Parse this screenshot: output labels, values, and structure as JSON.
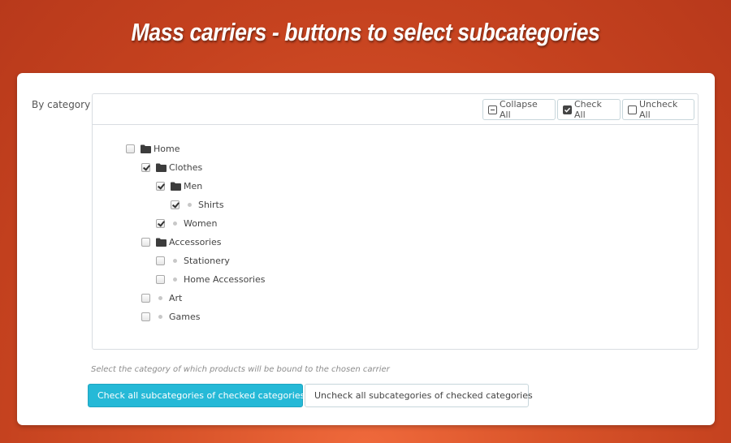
{
  "headline": "Mass carriers - buttons to select subcategories",
  "form": {
    "by_category_label": "By category",
    "hint": "Select the category of which products will be bound to the chosen carrier"
  },
  "toolbar": {
    "collapse_all": "Collapse All",
    "check_all": "Check All",
    "uncheck_all": "Uncheck All"
  },
  "tree": [
    {
      "label": "Home",
      "checked": false,
      "folder": true,
      "depth": 0
    },
    {
      "label": "Clothes",
      "checked": true,
      "folder": true,
      "depth": 1
    },
    {
      "label": "Men",
      "checked": true,
      "folder": true,
      "depth": 2
    },
    {
      "label": "Shirts",
      "checked": true,
      "folder": false,
      "depth": 3
    },
    {
      "label": "Women",
      "checked": true,
      "folder": false,
      "depth": 2
    },
    {
      "label": "Accessories",
      "checked": false,
      "folder": true,
      "depth": 1
    },
    {
      "label": "Stationery",
      "checked": false,
      "folder": false,
      "depth": 2
    },
    {
      "label": "Home Accessories",
      "checked": false,
      "folder": false,
      "depth": 2
    },
    {
      "label": "Art",
      "checked": false,
      "folder": false,
      "depth": 1
    },
    {
      "label": "Games",
      "checked": false,
      "folder": false,
      "depth": 1
    }
  ],
  "actions": {
    "check_subcategories": "Check all subcategories of checked categories",
    "uncheck_subcategories": "Uncheck all subcategories of checked categories"
  },
  "colors": {
    "background": "#c5421f",
    "primary_button": "#25b9d7"
  }
}
